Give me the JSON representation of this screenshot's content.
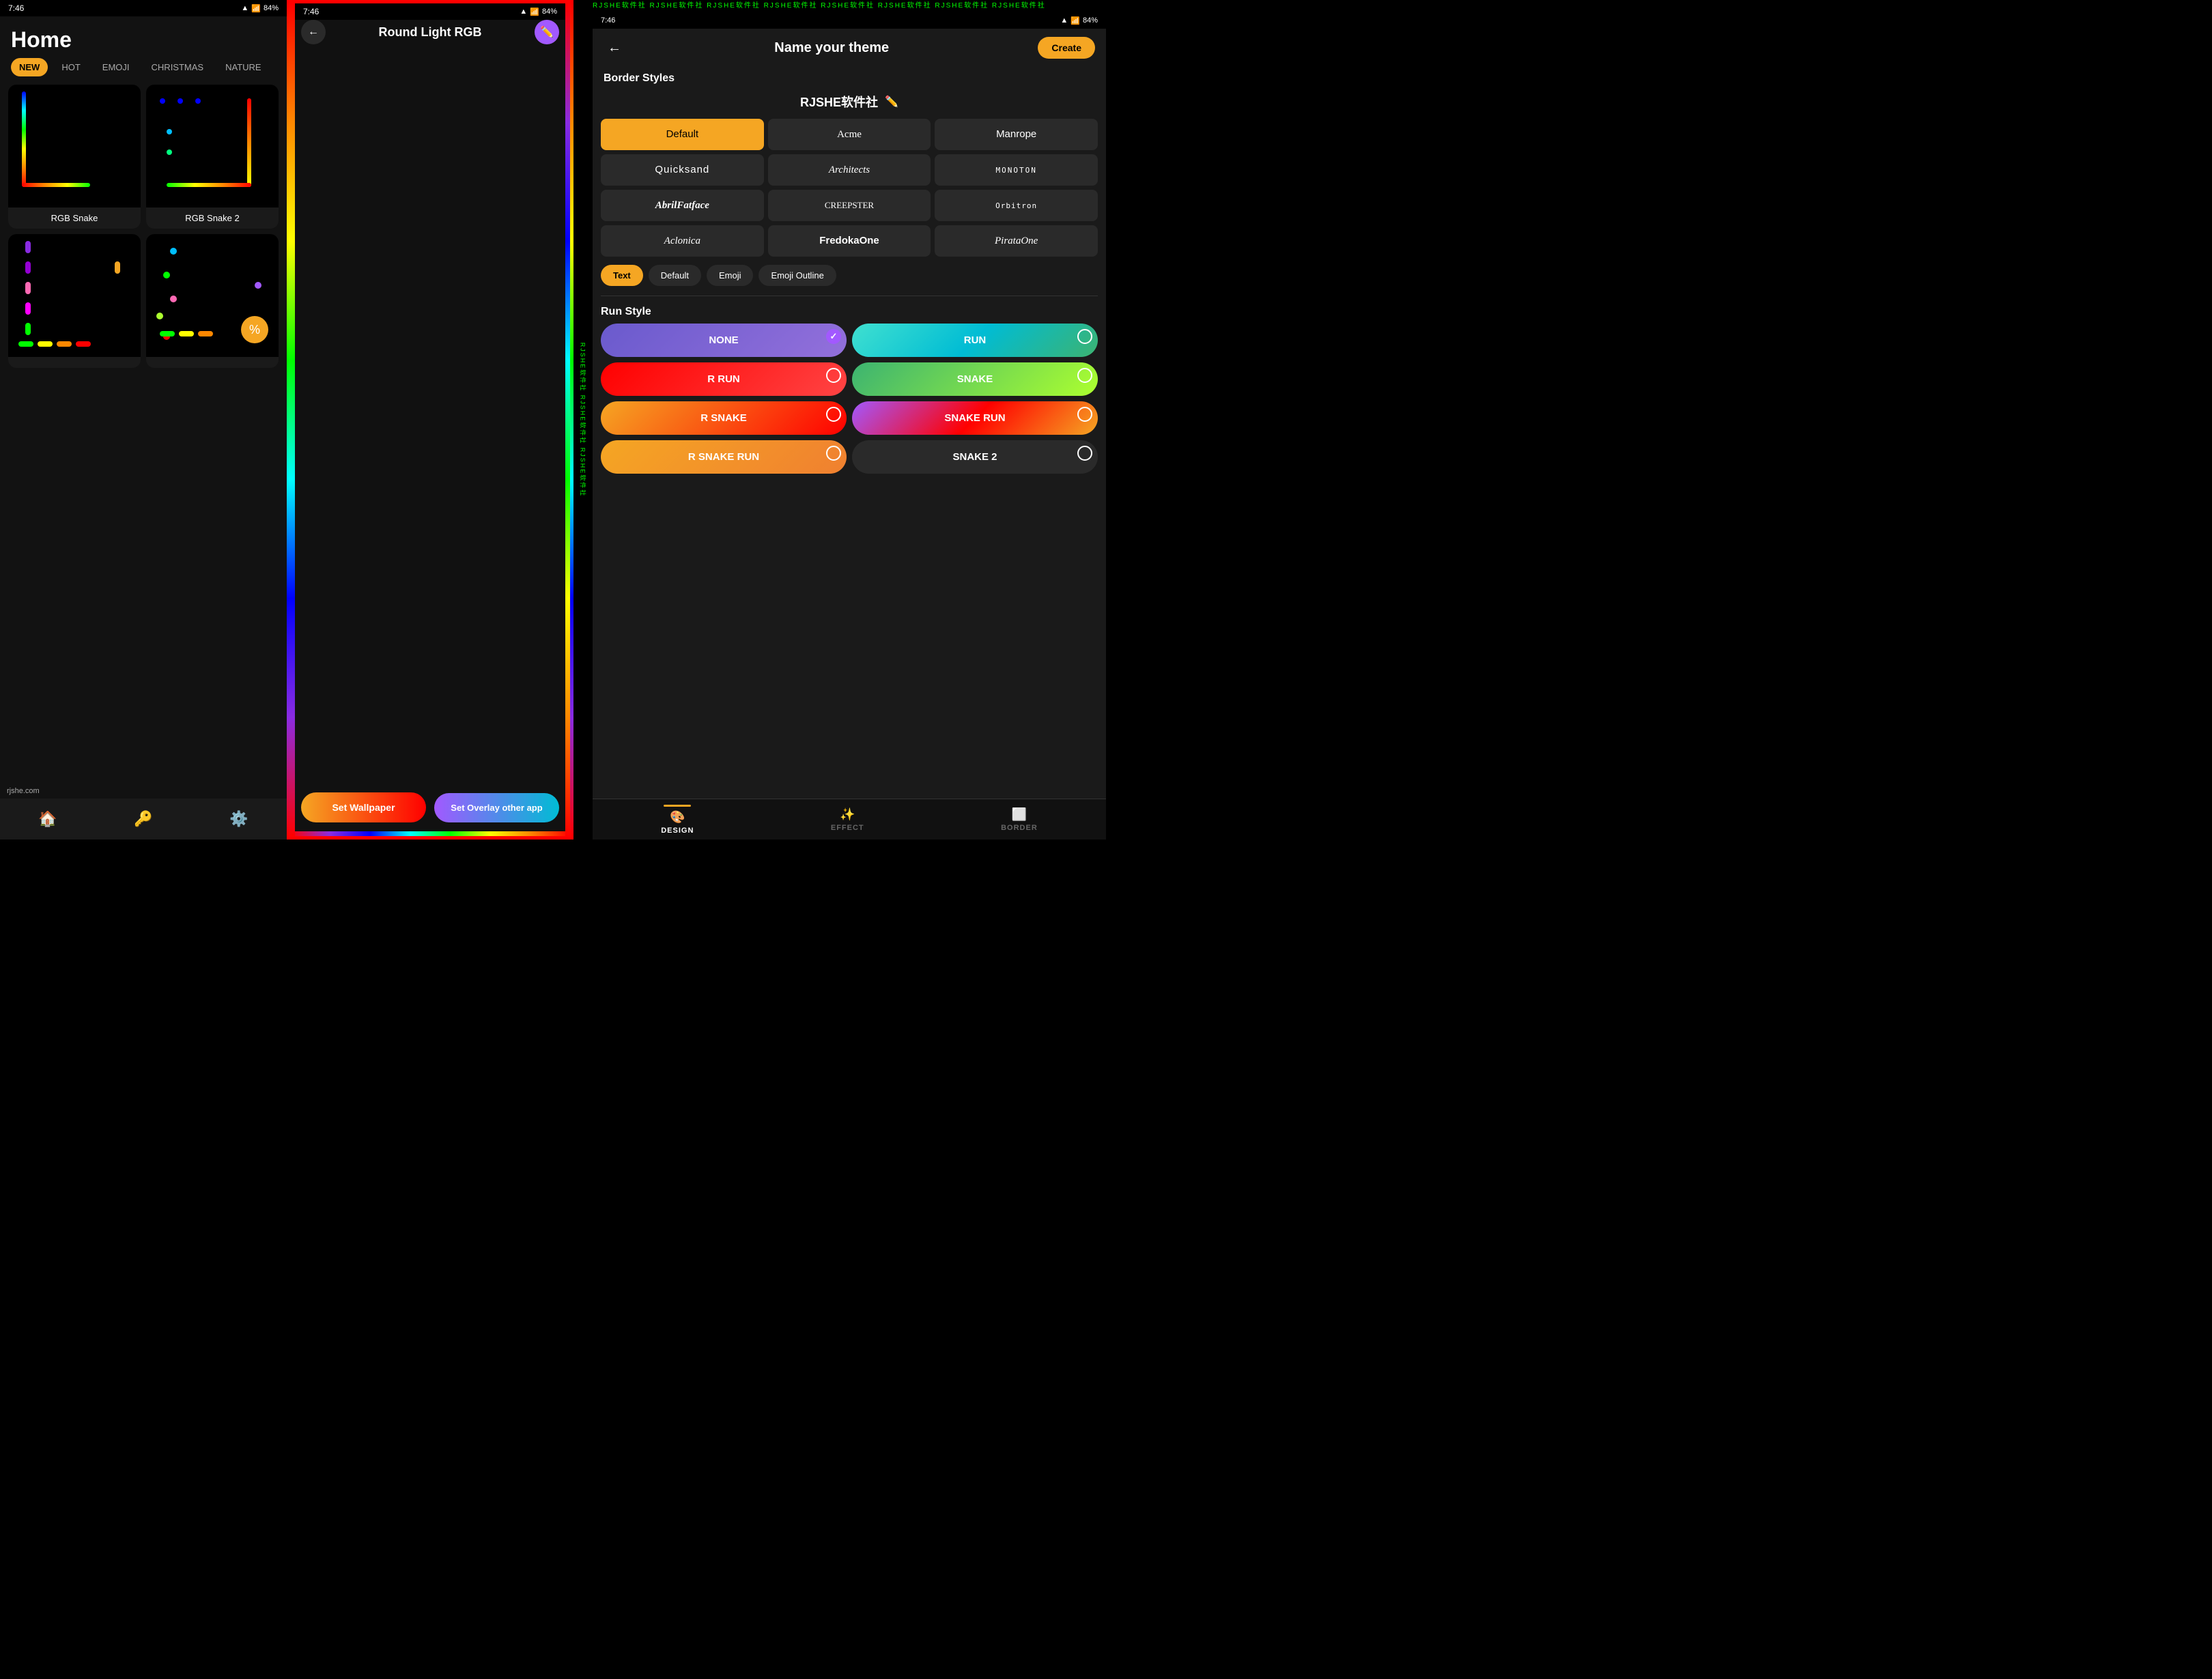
{
  "home": {
    "title": "Home",
    "status": {
      "time": "7:46",
      "battery": "84%"
    },
    "tabs": [
      {
        "label": "NEW",
        "active": true
      },
      {
        "label": "HOT",
        "active": false
      },
      {
        "label": "EMOJI",
        "active": false
      },
      {
        "label": "CHRISTMAS",
        "active": false
      },
      {
        "label": "NATURE",
        "active": false
      }
    ],
    "cards": [
      {
        "label": "RGB Snake"
      },
      {
        "label": "RGB Snake 2"
      },
      {
        "label": ""
      },
      {
        "label": ""
      }
    ],
    "watermark": "rjshe.com",
    "nav": {
      "home": "🏠",
      "key": "🔑",
      "settings": "⚙️"
    }
  },
  "preview": {
    "title": "Round Light RGB",
    "back": "←",
    "edit_icon": "✏️",
    "btn_wallpaper": "Set Wallpaper",
    "btn_overlay": "Set Overlay other app"
  },
  "editor": {
    "title": "Name your theme",
    "create_btn": "Create",
    "back": "←",
    "brand": "RJSHE软件社",
    "border_styles_label": "Border Styles",
    "fonts": [
      {
        "label": "Default",
        "active": true,
        "class": ""
      },
      {
        "label": "Acme",
        "active": false,
        "class": "font-acme"
      },
      {
        "label": "Manrope",
        "active": false,
        "class": "font-manrope"
      },
      {
        "label": "Quicksand",
        "active": false,
        "class": "font-quicksand"
      },
      {
        "label": "Architects",
        "active": false,
        "class": "font-architects"
      },
      {
        "label": "MONOTON",
        "active": false,
        "class": "font-monoton"
      },
      {
        "label": "AbrilFatface",
        "active": false,
        "class": "font-abril"
      },
      {
        "label": "CREEPSTER",
        "active": false,
        "class": "font-creepster"
      },
      {
        "label": "Orbitron",
        "active": false,
        "class": "font-orbitron"
      },
      {
        "label": "Aclonica",
        "active": false,
        "class": "font-aclonica"
      },
      {
        "label": "FredokaOne",
        "active": false,
        "class": "font-fredoka"
      },
      {
        "label": "PirataOne",
        "active": false,
        "class": "font-pirata"
      }
    ],
    "text_styles": [
      {
        "label": "Text",
        "active": true
      },
      {
        "label": "Default",
        "active": false
      },
      {
        "label": "Emoji",
        "active": false
      },
      {
        "label": "Emoji Outline",
        "active": false
      }
    ],
    "run_style_label": "Run Style",
    "run_styles": [
      {
        "label": "NONE",
        "active": true,
        "class": "run-btn-none"
      },
      {
        "label": "RUN",
        "active": false,
        "class": "run-btn-run"
      },
      {
        "label": "R RUN",
        "active": false,
        "class": "run-btn-rrun"
      },
      {
        "label": "SNAKE",
        "active": false,
        "class": "run-btn-snake"
      },
      {
        "label": "R SNAKE",
        "active": false,
        "class": "run-btn-rsnake"
      },
      {
        "label": "SNAKE RUN",
        "active": false,
        "class": "run-btn-snakerun"
      },
      {
        "label": "R SNAKE RUN",
        "active": false,
        "class": "run-btn-rsnakerun"
      },
      {
        "label": "SNAKE 2",
        "active": false,
        "class": "run-btn-snake2"
      }
    ],
    "bottom_tabs": [
      {
        "label": "DESIGN",
        "icon": "🎨",
        "active": true
      },
      {
        "label": "EFFECT",
        "icon": "✨",
        "active": false
      },
      {
        "label": "BORDER",
        "icon": "⬜",
        "active": false
      }
    ]
  }
}
